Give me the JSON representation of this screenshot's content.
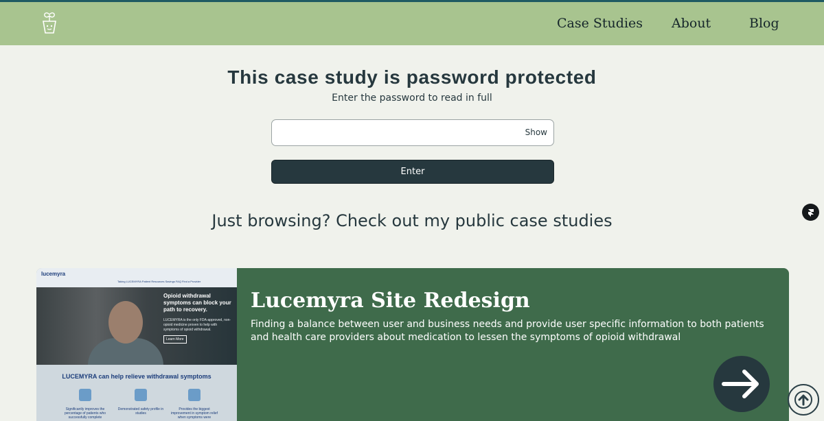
{
  "nav": {
    "logo_icon": "plant-pot-icon",
    "links": [
      "Case Studies",
      "About",
      "Blog"
    ]
  },
  "protect": {
    "title": "This case study is password protected",
    "subtitle": "Enter the password to read in full",
    "password_value": "",
    "show_label": "Show",
    "enter_label": "Enter"
  },
  "browse_text": "Just browsing? Check out my public case studies",
  "case_card": {
    "title": "Lucemyra Site Redesign",
    "description": "Finding a balance between user and business needs and provide user specific information to both patients and health care providers about medication to lessen the symptoms of opioid withdrawal",
    "arrow_icon": "arrow-right-icon",
    "thumbnail": {
      "logo": "lucemyra",
      "nav": "Taking LUCEMYRA   Patient Resources   Savings   FAQ   Find a Provider",
      "hero_title": "Opioid withdrawal symptoms can block your path to recovery.",
      "hero_body": "LUCEMYRA is the only FDA-approved, non-opioid medicine proven to help with symptoms of opioid withdrawal.",
      "hero_button": "Learn More",
      "band_title": "LUCEMYRA can help relieve withdrawal symptoms",
      "features": [
        "Significantly improves the percentage of patients who successfully complete",
        "Demonstrated safety profile in studies",
        "Provides the biggest improvement in symptom relief when symptoms were"
      ]
    }
  },
  "floating_badge_icon": "framer-icon",
  "scroll_top_icon": "arrow-up-icon",
  "colors": {
    "nav_bg": "#a8c48f",
    "page_bg": "#f0f2ec",
    "primary_dark": "#26383e",
    "card_bg": "#3f6b4b"
  }
}
